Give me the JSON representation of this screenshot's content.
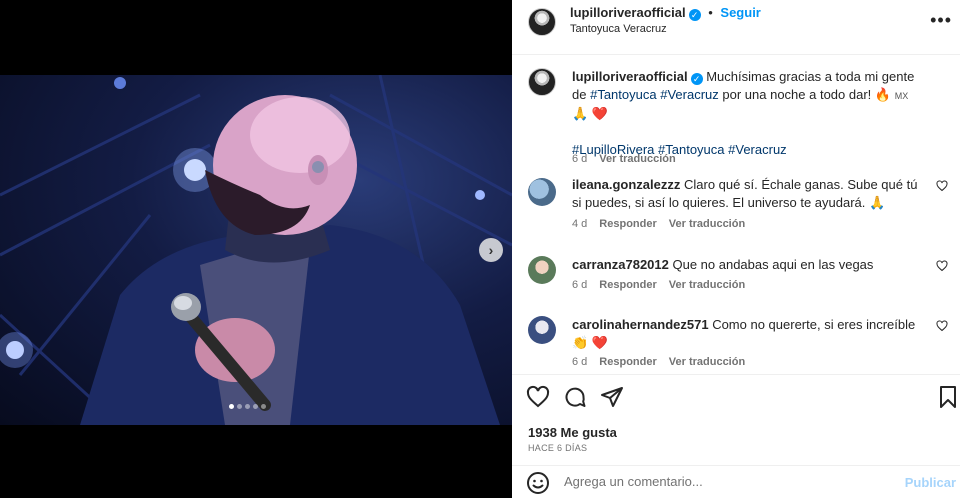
{
  "post": {
    "username": "lupilloriveraofficial",
    "verified_icon": "verified-badge-icon",
    "follow_label": "Seguir",
    "follow_separator": "•",
    "location": "Tantoyuca Veracruz",
    "more_icon": "more-options-icon",
    "more_label": "•••",
    "next_label": "›",
    "media_slides": 5,
    "media_active_slide": 1
  },
  "caption": {
    "username": "lupilloriveraofficial",
    "text_1": "Muchísimas gracias a toda mi gente de",
    "tag_1": "#Tantoyuca",
    "tag_2": "#Veracruz",
    "text_2": "por una noche a todo dar! 🔥",
    "flag": "MX",
    "emojis": "🙏 ❤️",
    "tags_line": [
      "#LupilloRivera",
      "#Tantoyuca",
      "#Veracruz"
    ],
    "time": "6 d",
    "translate": "Ver traducción"
  },
  "comments": [
    {
      "username": "ileana.gonzalezzz",
      "text": "Claro qué sí. Échale ganas. Sube qué tú si puedes, si así lo quieres. El universo te ayudará. 🙏",
      "time": "4 d",
      "reply": "Responder",
      "translate": "Ver traducción"
    },
    {
      "username": "carranza782012",
      "text": "Que no andabas aqui en las vegas",
      "time": "6 d",
      "reply": "Responder",
      "translate": "Ver traducción"
    },
    {
      "username": "carolinahernandez571",
      "text": "Como no quererte, si eres increíble 👏 ❤️",
      "time": "6 d",
      "reply": "Responder",
      "translate": "Ver traducción"
    }
  ],
  "engagement": {
    "likes": "1938 Me gusta",
    "ago": "HACE 6 DÍAS",
    "icons": [
      "like-icon",
      "comment-icon",
      "share-icon",
      "save-icon"
    ]
  },
  "composer": {
    "placeholder": "Agrega un comentario...",
    "publish_label": "Publicar",
    "emoji_icon": "emoji-icon"
  },
  "colors": {
    "accent": "#0095f6",
    "hashtag": "#00376b",
    "muted": "#737373",
    "heart": "#ed4956"
  }
}
